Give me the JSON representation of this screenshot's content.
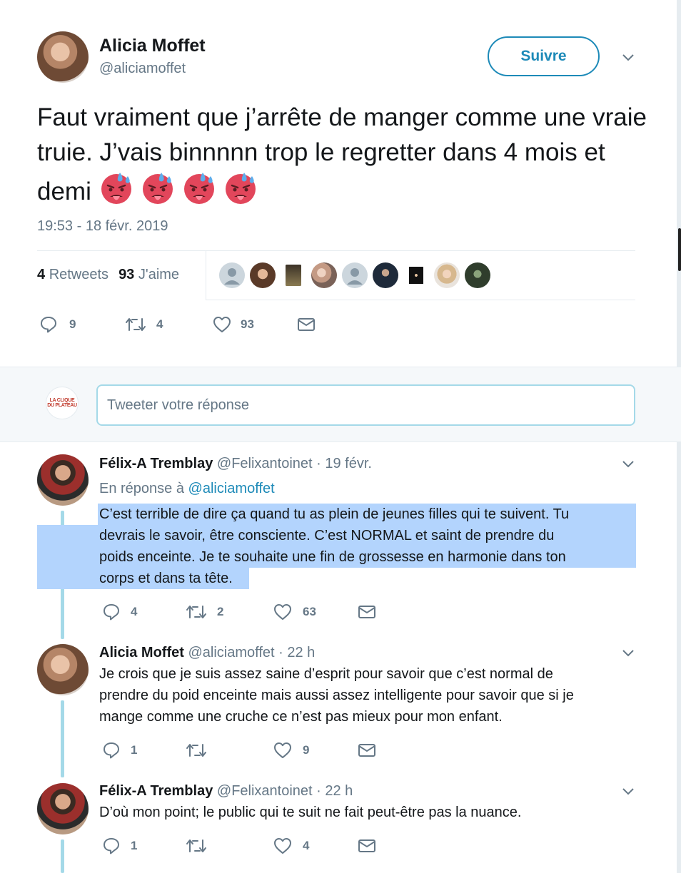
{
  "main_tweet": {
    "name": "Alicia Moffet",
    "handle": "@aliciamoffet",
    "follow_label": "Suivre",
    "text": "Faut vraiment que j’arrête de manger comme une vraie truie. J’vais binnnnn trop le regretter dans 4 mois et demi",
    "emoji_name": "hot-face-emoji",
    "emoji_count": 4,
    "timestamp": "19:53 - 18 févr. 2019",
    "retweets_count": "4",
    "retweets_label": "Retweets",
    "likes_count": "93",
    "likes_label": "J'aime",
    "actions": {
      "replies": "9",
      "retweets": "4",
      "likes": "93"
    }
  },
  "reply_box": {
    "placeholder": "Tweeter votre réponse",
    "logo_lines": [
      "LA CLIQUE",
      "DU PLATEAU"
    ]
  },
  "replies": [
    {
      "name": "Félix-A Tremblay",
      "handle": "@Felixantoinet",
      "time": "· 19 févr.",
      "in_reply_prefix": "En réponse à",
      "in_reply_to": "@aliciamoffet",
      "lines": [
        "C’est terrible de dire ça quand tu as plein de jeunes filles qui te suivent. Tu",
        "devrais le savoir, être consciente. C’est NORMAL et saint de prendre du",
        "poids enceinte. Je te souhaite une fin de grossesse en harmonie dans ton",
        "corps et dans ta tête."
      ],
      "actions": {
        "replies": "4",
        "retweets": "2",
        "likes": "63"
      }
    },
    {
      "name": "Alicia Moffet",
      "handle": "@aliciamoffet",
      "time": "· 22 h",
      "lines": [
        "Je crois que je suis assez saine d’esprit pour savoir que c’est normal de",
        "prendre du poid enceinte mais aussi assez intelligente pour savoir que si je",
        "mange comme une cruche ce n’est pas mieux pour mon enfant."
      ],
      "actions": {
        "replies": "1",
        "retweets": "",
        "likes": "9"
      }
    },
    {
      "name": "Félix-A Tremblay",
      "handle": "@Felixantoinet",
      "time": "· 22 h",
      "lines": [
        "D’où mon point; le public qui te suit ne fait peut-être pas la nuance."
      ],
      "actions": {
        "replies": "1",
        "retweets": "",
        "likes": "4"
      }
    }
  ],
  "colors": {
    "accent": "#1d8ab8",
    "muted": "#657786",
    "thread_line": "#a4d9e8",
    "selection": "#b3d4fd"
  }
}
